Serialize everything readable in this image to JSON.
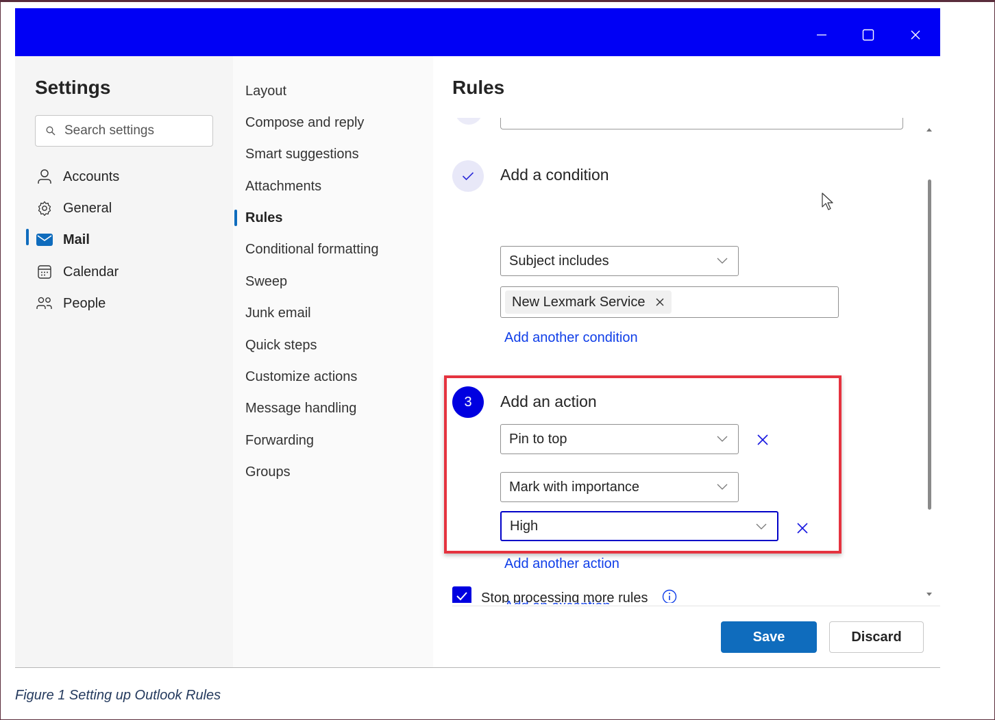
{
  "window": {
    "controls": {
      "minimize_icon": "minimize-icon",
      "maximize_icon": "maximize-icon",
      "close_icon": "close-icon"
    },
    "accent_color": "#0000f5"
  },
  "left_nav": {
    "title": "Settings",
    "search_placeholder": "Search settings",
    "items": [
      {
        "label": "Accounts",
        "icon": "person-icon",
        "active": false
      },
      {
        "label": "General",
        "icon": "gear-icon",
        "active": false
      },
      {
        "label": "Mail",
        "icon": "mail-icon",
        "active": true
      },
      {
        "label": "Calendar",
        "icon": "calendar-icon",
        "active": false
      },
      {
        "label": "People",
        "icon": "people-icon",
        "active": false
      }
    ]
  },
  "mail_nav": {
    "items": [
      {
        "label": "Layout",
        "active": false
      },
      {
        "label": "Compose and reply",
        "active": false
      },
      {
        "label": "Smart suggestions",
        "active": false
      },
      {
        "label": "Attachments",
        "active": false
      },
      {
        "label": "Rules",
        "active": true
      },
      {
        "label": "Conditional formatting",
        "active": false
      },
      {
        "label": "Sweep",
        "active": false
      },
      {
        "label": "Junk email",
        "active": false
      },
      {
        "label": "Quick steps",
        "active": false
      },
      {
        "label": "Customize actions",
        "active": false
      },
      {
        "label": "Message handling",
        "active": false
      },
      {
        "label": "Forwarding",
        "active": false
      },
      {
        "label": "Groups",
        "active": false
      }
    ]
  },
  "rules": {
    "title": "Rules",
    "condition": {
      "step_title": "Add a condition",
      "step_state": "completed",
      "condition_type": "Subject includes",
      "tag": "New Lexmark Service",
      "add_link": "Add another condition"
    },
    "action": {
      "step_number": "3",
      "step_title": "Add an action",
      "action_1": "Pin to top",
      "action_2": "Mark with importance",
      "action_2_value": "High",
      "add_link": "Add another action"
    },
    "exception_link": "Add an exception",
    "stop_processing": {
      "label": "Stop processing more rules",
      "checked": true
    },
    "save_label": "Save",
    "discard_label": "Discard"
  },
  "caption": "Figure 1 Setting up Outlook Rules"
}
